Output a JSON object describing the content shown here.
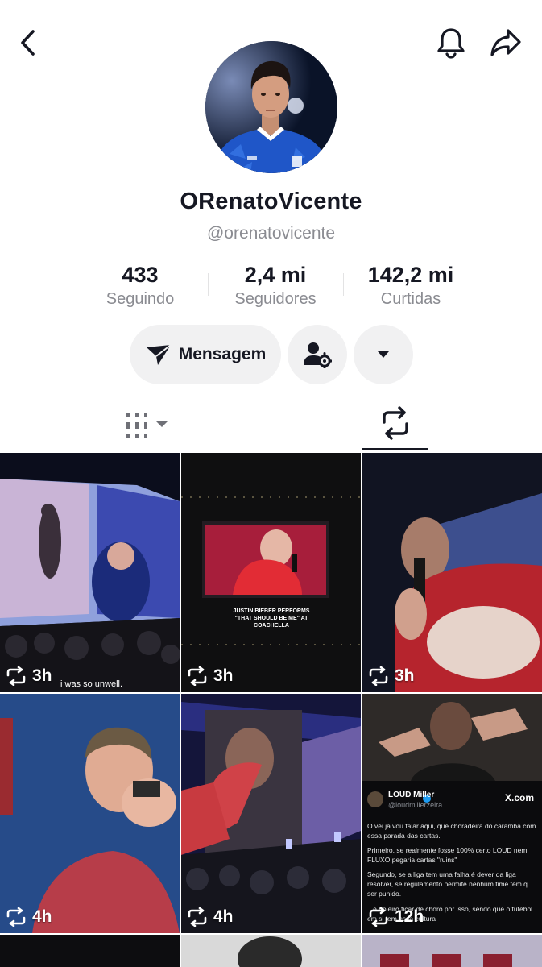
{
  "header": {
    "back_icon": "chevron-left-icon",
    "bell_icon": "bell-icon",
    "share_icon": "share-arrow-icon"
  },
  "profile": {
    "display_name": "ORenatoVicente",
    "handle": "@orenatovicente"
  },
  "stats": [
    {
      "value": "433",
      "label": "Seguindo"
    },
    {
      "value": "2,4 mi",
      "label": "Seguidores"
    },
    {
      "value": "142,2 mi",
      "label": "Curtidas"
    }
  ],
  "actions": {
    "message_label": "Mensagem",
    "message_icon": "send-icon",
    "follow_icon": "user-settings-icon",
    "more_icon": "triangle-down-icon"
  },
  "tabs": {
    "videos_icon": "grid-filter-icon",
    "reposts_icon": "repost-icon",
    "active": "reposts"
  },
  "videos": [
    {
      "time": "3h",
      "caption": "i was so unwell."
    },
    {
      "time": "3h",
      "caption": "JUSTIN BIEBER PERFORMS \"THAT SHOULD BE ME\" AT COACHELLA"
    },
    {
      "time": "3h",
      "caption": ""
    },
    {
      "time": "4h",
      "caption": ""
    },
    {
      "time": "4h",
      "caption": ""
    },
    {
      "time": "12h",
      "caption": ""
    }
  ],
  "tweet": {
    "author": "LOUD Miller",
    "username": "@loudmillerzeira",
    "source": "X.com",
    "line1": "O véi já vou falar aqui, que choradeira do caramba com essa parada das cartas.",
    "line2": "Primeiro, se realmente fosse 100% certo LOUD nem FLUXO pegaria cartas \"ruins\"",
    "line3": "Segundo, se a liga tem uma falha é dever da liga resolver, se regulamento permite nenhum time tem q ser punido.",
    "line4": "...é boleiro ficar de choro por isso, sendo que o futebol em si tem essa cultura"
  }
}
